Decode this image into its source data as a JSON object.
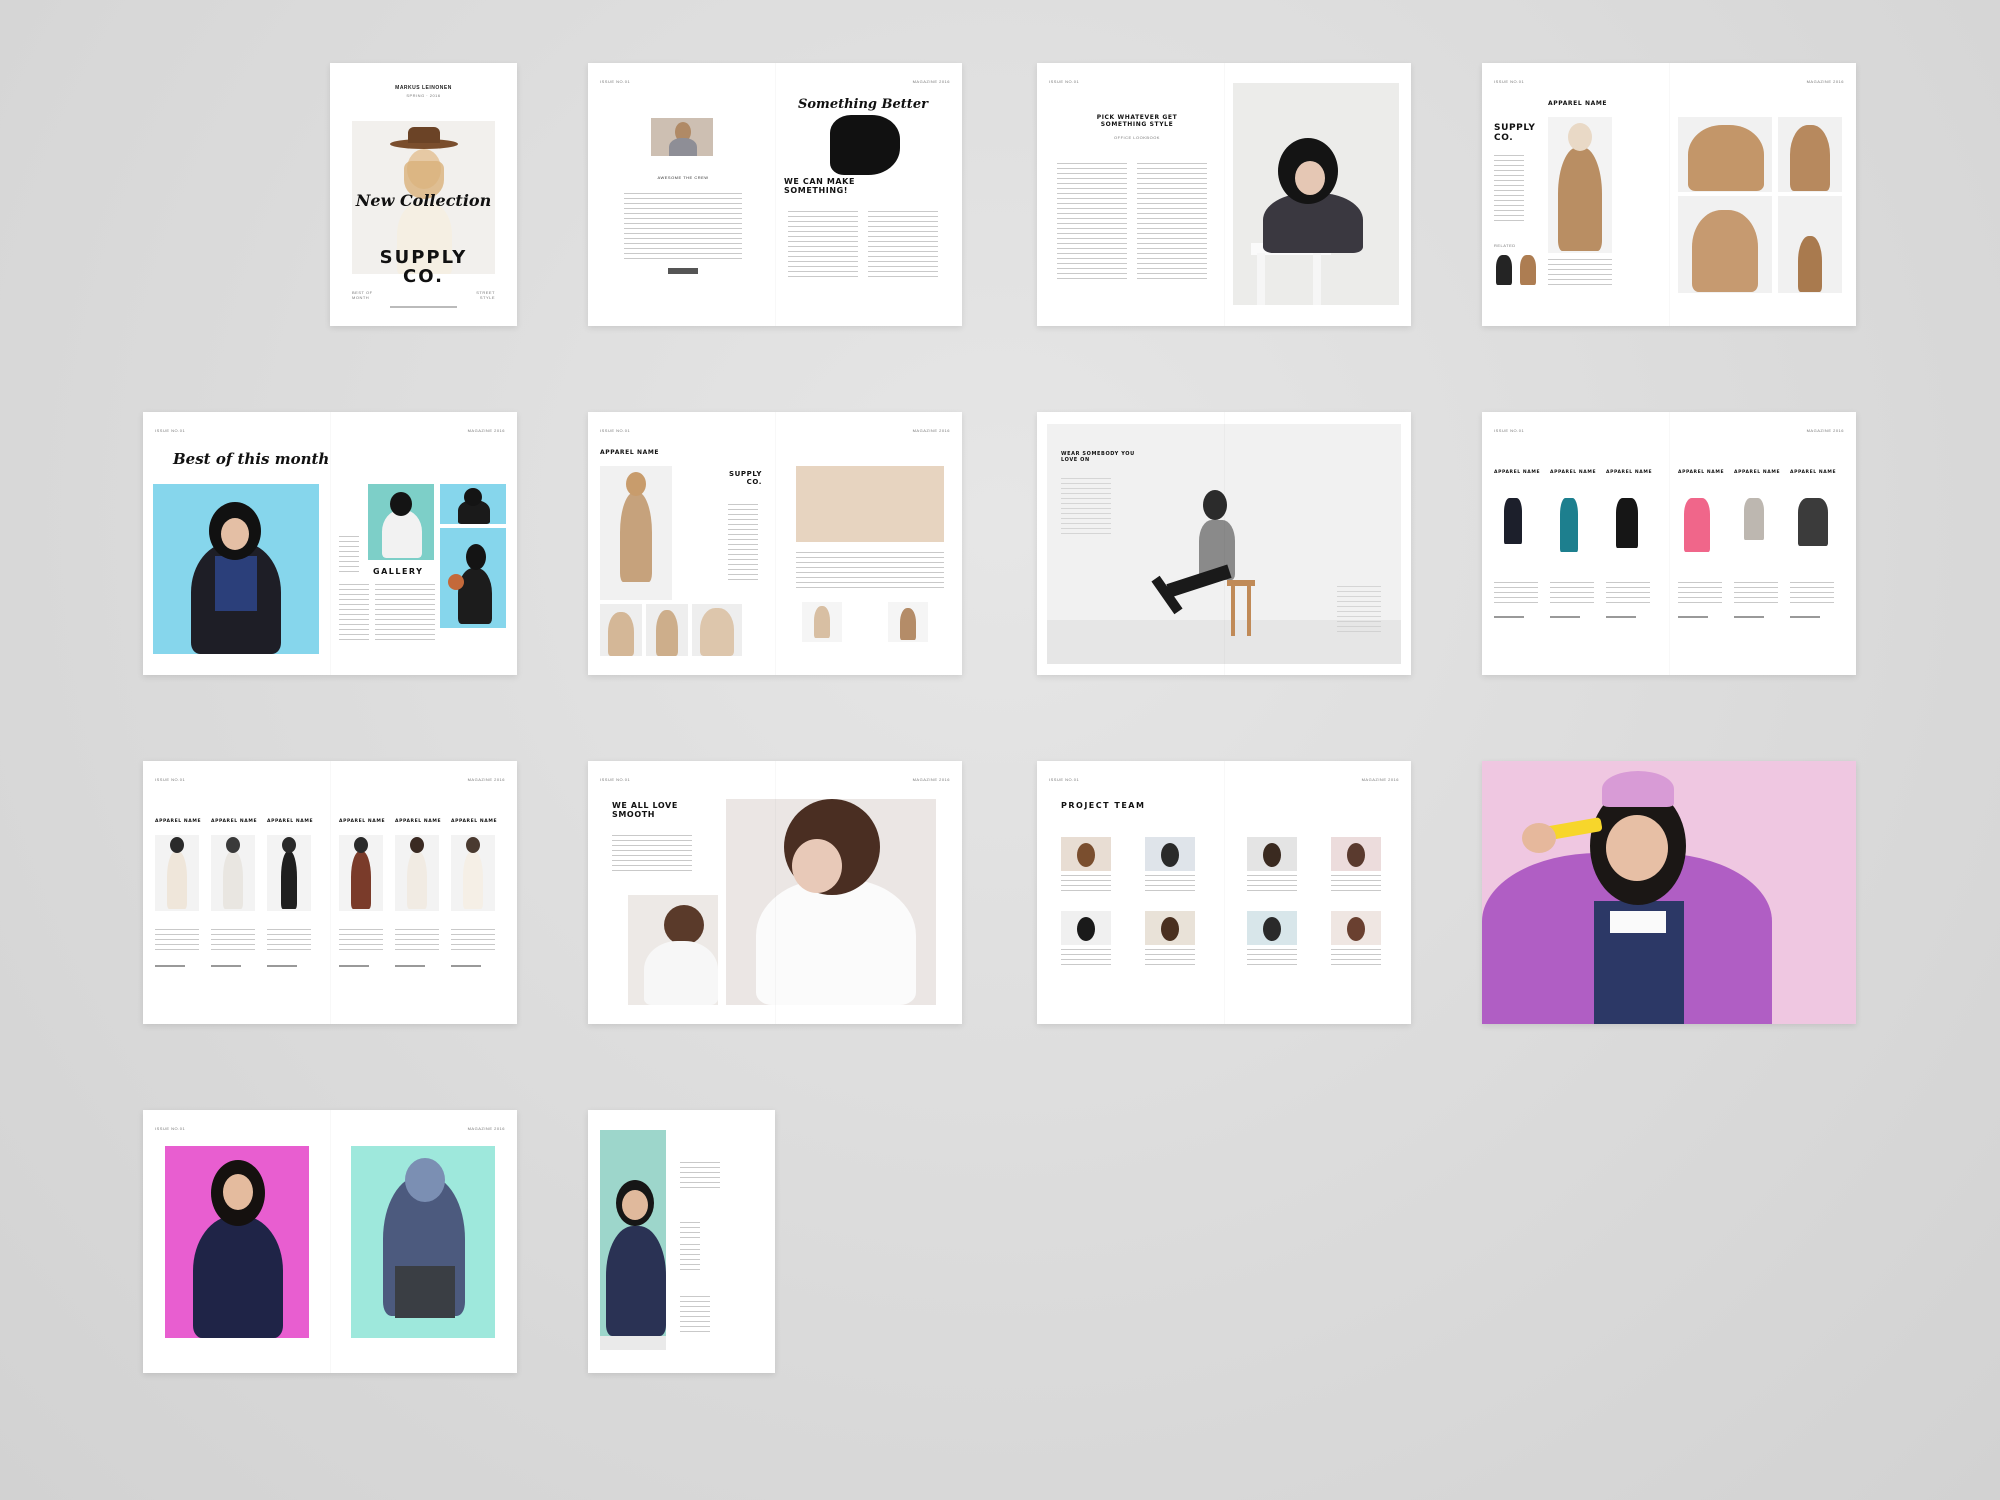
{
  "cover": {
    "publisher": "MARKUS LEINONEN",
    "subtitle": "SPRING · 2016",
    "script_title": "New Collection",
    "brand": "SUPPLY CO.",
    "left_note": "BEST OF MONTH",
    "right_note": "STREET STYLE"
  },
  "spread_intro": {
    "script_title": "Something Better",
    "headline": "WE CAN MAKE SOMETHING!",
    "caption": "AWESOME THE CREW"
  },
  "spread_editorial": {
    "headline": "PICK WHATEVER GET SOMETHING STYLE",
    "caption": "OFFICE LOOKBOOK"
  },
  "spread_apparel": {
    "brand": "SUPPLY CO.",
    "heading": "APPAREL NAME",
    "caption": "RELATED"
  },
  "spread_best": {
    "script_title": "Best of this month",
    "gallery": "GALLERY"
  },
  "spread_apparel2": {
    "heading": "APPAREL NAME",
    "brand": "SUPPLY CO."
  },
  "spread_man": {
    "headline": "WEAR SOMEBODY YOU LOVE ON"
  },
  "spread_products1": {
    "heading": "APPAREL NAME"
  },
  "spread_products2": {
    "heading": "APPAREL NAME"
  },
  "spread_smooth": {
    "headline": "WE ALL LOVE SMOOTH"
  },
  "spread_team": {
    "headline": "PROJECT TEAM"
  },
  "colors": {
    "background": "#d9d9d9",
    "sky_blue": "#86d6ec",
    "mint": "#9ee8dc",
    "magenta": "#e85ed0",
    "pink_bg": "#efc7e1"
  }
}
